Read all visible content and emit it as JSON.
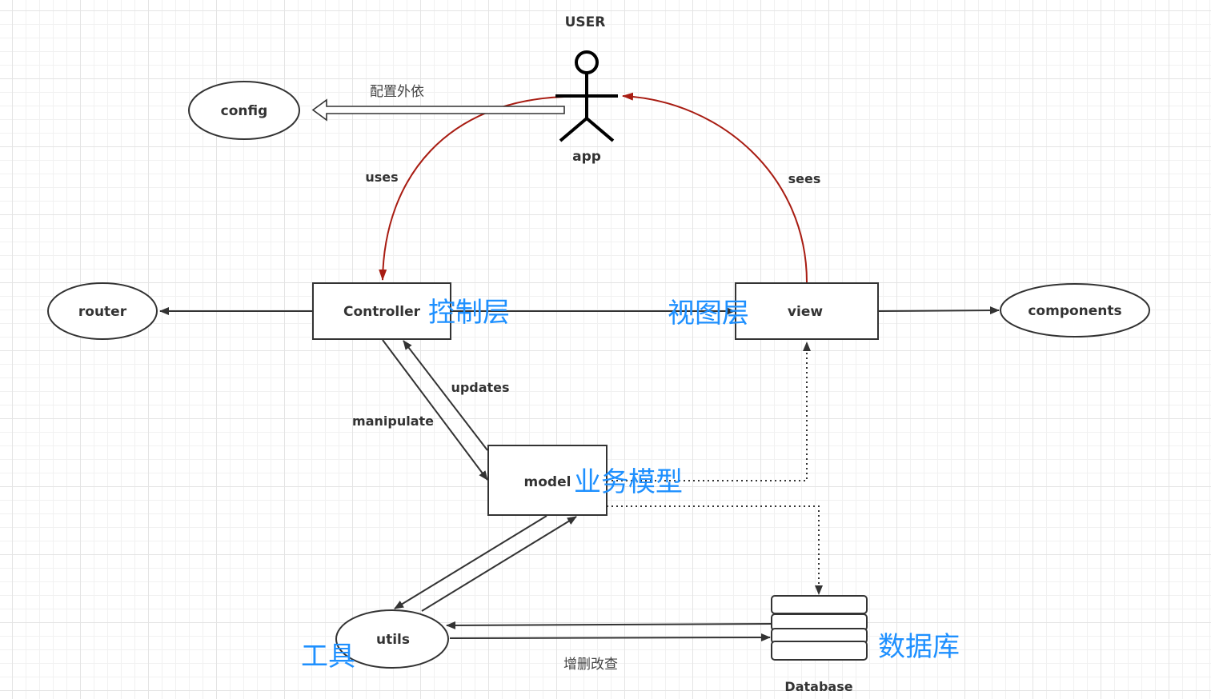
{
  "diagram": {
    "actor": {
      "title": "USER",
      "label": "app"
    },
    "nodes": {
      "config": "config",
      "router": "router",
      "controller": "Controller",
      "view": "view",
      "components": "components",
      "model": "model",
      "utils": "utils",
      "database": "Database"
    },
    "annotations": {
      "controller": "控制层",
      "view": "视图层",
      "model": "业务模型",
      "utils": "工具",
      "database": "数据库"
    },
    "edge_labels": {
      "config_dep": "配置外依",
      "uses": "uses",
      "sees": "sees",
      "updates": "updates",
      "manipulate": "manipulate",
      "crud": "增删改查"
    },
    "colors": {
      "stroke": "#333333",
      "accent_red": "#a81c12",
      "annotation_blue": "#1e90ff",
      "grid": "#e4e4e4"
    }
  }
}
